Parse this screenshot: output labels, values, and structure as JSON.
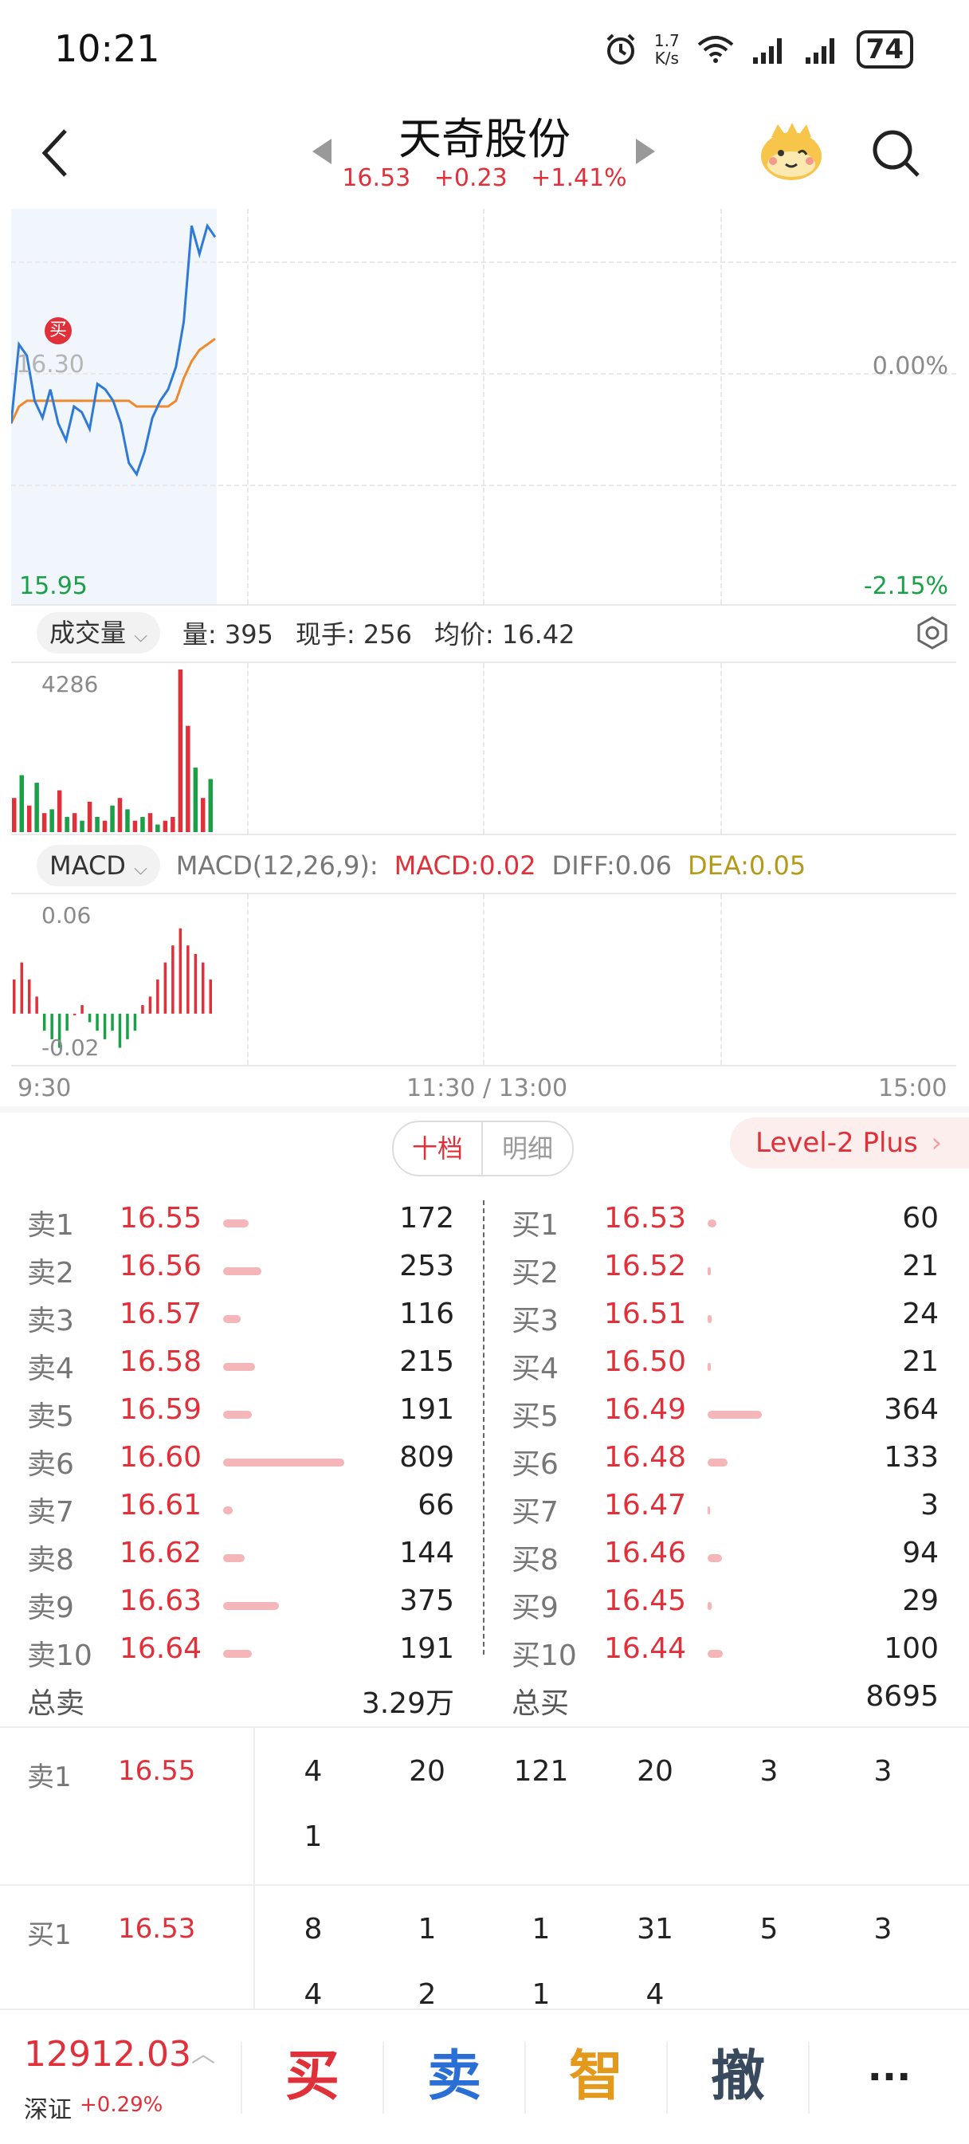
{
  "status_bar": {
    "time": "10:21",
    "net_speed_top": "1.7",
    "net_speed_bottom": "K/s",
    "battery": "74",
    "icons": [
      "alarm-icon",
      "wifi-icon",
      "signal-icon",
      "signal-icon",
      "battery-icon"
    ]
  },
  "header": {
    "title": "天奇股份",
    "price": "16.53",
    "change": "+0.23",
    "change_pct": "+1.41%"
  },
  "intraday_chart": {
    "price_label_left": "16.30",
    "low_label": "15.95",
    "pct_mid": "0.00%",
    "pct_low": "-2.15%",
    "marker": "买",
    "price_line": [
      16.27,
      16.41,
      16.39,
      16.31,
      16.28,
      16.33,
      16.27,
      16.24,
      16.3,
      16.29,
      16.26,
      16.34,
      16.33,
      16.31,
      16.27,
      16.2,
      16.18,
      16.22,
      16.28,
      16.31,
      16.33,
      16.37,
      16.45,
      16.62,
      16.57,
      16.62,
      16.6
    ],
    "avg_line": [
      16.27,
      16.3,
      16.31,
      16.31,
      16.31,
      16.31,
      16.31,
      16.31,
      16.31,
      16.31,
      16.31,
      16.31,
      16.31,
      16.31,
      16.31,
      16.31,
      16.3,
      16.3,
      16.3,
      16.3,
      16.3,
      16.31,
      16.35,
      16.38,
      16.4,
      16.41,
      16.42
    ],
    "y_range": [
      15.95,
      16.65
    ]
  },
  "volume_panel": {
    "indicator": "成交量",
    "vol_label": "量: 395",
    "hand_label": "现手: 256",
    "avg_label": "均价: 16.42",
    "max_label": "4286",
    "bars": [
      {
        "v": 900,
        "c": "r"
      },
      {
        "v": 1500,
        "c": "g"
      },
      {
        "v": 700,
        "c": "r"
      },
      {
        "v": 1300,
        "c": "g"
      },
      {
        "v": 500,
        "c": "r"
      },
      {
        "v": 600,
        "c": "g"
      },
      {
        "v": 1100,
        "c": "r"
      },
      {
        "v": 400,
        "c": "g"
      },
      {
        "v": 500,
        "c": "r"
      },
      {
        "v": 300,
        "c": "g"
      },
      {
        "v": 800,
        "c": "r"
      },
      {
        "v": 400,
        "c": "g"
      },
      {
        "v": 300,
        "c": "r"
      },
      {
        "v": 700,
        "c": "g"
      },
      {
        "v": 900,
        "c": "r"
      },
      {
        "v": 600,
        "c": "g"
      },
      {
        "v": 300,
        "c": "r"
      },
      {
        "v": 400,
        "c": "g"
      },
      {
        "v": 500,
        "c": "r"
      },
      {
        "v": 200,
        "c": "g"
      },
      {
        "v": 300,
        "c": "r"
      },
      {
        "v": 400,
        "c": "r"
      },
      {
        "v": 4286,
        "c": "r"
      },
      {
        "v": 2800,
        "c": "r"
      },
      {
        "v": 1700,
        "c": "g"
      },
      {
        "v": 900,
        "c": "r"
      },
      {
        "v": 1400,
        "c": "g"
      }
    ]
  },
  "macd_panel": {
    "indicator": "MACD",
    "params": "MACD(12,26,9):",
    "macd": "MACD:0.02",
    "diff": "DIFF:0.06",
    "dea": "DEA:0.05",
    "max_label": "0.06",
    "min_label": "-0.02",
    "hist": [
      0.02,
      0.03,
      0.02,
      0.01,
      -0.01,
      -0.015,
      -0.02,
      -0.01,
      0.0,
      0.005,
      -0.005,
      -0.01,
      -0.015,
      -0.01,
      -0.02,
      -0.015,
      -0.01,
      0.005,
      0.01,
      0.02,
      0.03,
      0.04,
      0.05,
      0.04,
      0.035,
      0.03,
      0.02
    ]
  },
  "time_axis": {
    "start": "9:30",
    "mid": "11:30 / 13:00",
    "end": "15:00"
  },
  "book_tabs": {
    "tab1": "十档",
    "tab2": "明细",
    "level2": "Level-2 Plus"
  },
  "order_book": {
    "sell": [
      {
        "label": "卖1",
        "price": "16.55",
        "vol": "172"
      },
      {
        "label": "卖2",
        "price": "16.56",
        "vol": "253"
      },
      {
        "label": "卖3",
        "price": "16.57",
        "vol": "116"
      },
      {
        "label": "卖4",
        "price": "16.58",
        "vol": "215"
      },
      {
        "label": "卖5",
        "price": "16.59",
        "vol": "191"
      },
      {
        "label": "卖6",
        "price": "16.60",
        "vol": "809"
      },
      {
        "label": "卖7",
        "price": "16.61",
        "vol": "66"
      },
      {
        "label": "卖8",
        "price": "16.62",
        "vol": "144"
      },
      {
        "label": "卖9",
        "price": "16.63",
        "vol": "375"
      },
      {
        "label": "卖10",
        "price": "16.64",
        "vol": "191"
      }
    ],
    "buy": [
      {
        "label": "买1",
        "price": "16.53",
        "vol": "60"
      },
      {
        "label": "买2",
        "price": "16.52",
        "vol": "21"
      },
      {
        "label": "买3",
        "price": "16.51",
        "vol": "24"
      },
      {
        "label": "买4",
        "price": "16.50",
        "vol": "21"
      },
      {
        "label": "买5",
        "price": "16.49",
        "vol": "364"
      },
      {
        "label": "买6",
        "price": "16.48",
        "vol": "133"
      },
      {
        "label": "买7",
        "price": "16.47",
        "vol": "3"
      },
      {
        "label": "买8",
        "price": "16.46",
        "vol": "94"
      },
      {
        "label": "买9",
        "price": "16.45",
        "vol": "29"
      },
      {
        "label": "买10",
        "price": "16.44",
        "vol": "100"
      }
    ],
    "total_sell_label": "总卖",
    "total_sell": "3.29万",
    "total_buy_label": "总买",
    "total_buy": "8695"
  },
  "queue": {
    "sell1_label": "卖1",
    "sell1_price": "16.55",
    "sell1_orders": [
      "4",
      "20",
      "121",
      "20",
      "3",
      "3",
      "1"
    ],
    "buy1_label": "买1",
    "buy1_price": "16.53",
    "buy1_orders": [
      "8",
      "1",
      "1",
      "31",
      "5",
      "3",
      "4",
      "2",
      "1",
      "4"
    ]
  },
  "bottom_bar": {
    "index_value": "12912.03",
    "index_name": "深证",
    "index_change": "+0.29%",
    "buy": "买",
    "sell": "卖",
    "smart": "智",
    "cancel": "撤",
    "more": "···"
  }
}
